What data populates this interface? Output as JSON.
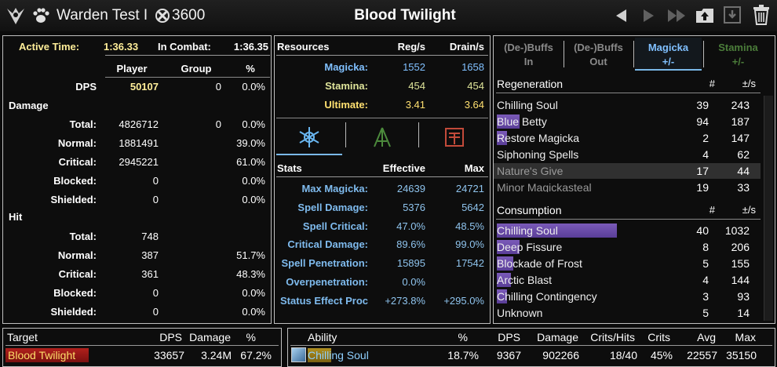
{
  "topbar": {
    "player": "Warden Test I",
    "cp": "3600",
    "title": "Blood Twilight"
  },
  "left": {
    "active_label": "Active Time:",
    "active_val": "1:36.33",
    "combat_label": "In Combat:",
    "combat_val": "1:36.35",
    "col_player": "Player",
    "col_group": "Group",
    "col_pct": "%",
    "dps_label": "DPS",
    "dps_player": "50107",
    "dps_group": "0",
    "dps_pct": "0.0%",
    "damage_header": "Damage",
    "damage": [
      {
        "label": "Total:",
        "player": "4826712",
        "group": "0",
        "pct": "0.0%"
      },
      {
        "label": "Normal:",
        "player": "1881491",
        "group": "",
        "pct": "39.0%"
      },
      {
        "label": "Critical:",
        "player": "2945221",
        "group": "",
        "pct": "61.0%"
      },
      {
        "label": "Blocked:",
        "player": "0",
        "group": "",
        "pct": "0.0%"
      },
      {
        "label": "Shielded:",
        "player": "0",
        "group": "",
        "pct": "0.0%"
      }
    ],
    "hit_header": "Hit",
    "hit": [
      {
        "label": "Total:",
        "player": "748",
        "pct": ""
      },
      {
        "label": "Normal:",
        "player": "387",
        "pct": "51.7%"
      },
      {
        "label": "Critical:",
        "player": "361",
        "pct": "48.3%"
      },
      {
        "label": "Blocked:",
        "player": "0",
        "pct": "0.0%"
      },
      {
        "label": "Shielded:",
        "player": "0",
        "pct": "0.0%"
      }
    ]
  },
  "middle": {
    "res_header": "Resources",
    "reg_header": "Reg/s",
    "drain_header": "Drain/s",
    "resources": [
      {
        "label": "Magicka:",
        "reg": "1552",
        "drain": "1658",
        "color": "#80c0ff"
      },
      {
        "label": "Stamina:",
        "reg": "454",
        "drain": "454",
        "color": "#dfe49a"
      },
      {
        "label": "Ultimate:",
        "reg": "3.41",
        "drain": "3.64",
        "color": "#ffe070"
      }
    ],
    "stats_header": "Stats",
    "eff_header": "Effective",
    "max_header": "Max",
    "stats": [
      {
        "label": "Max Magicka:",
        "eff": "24639",
        "max": "24721"
      },
      {
        "label": "Spell Damage:",
        "eff": "5376",
        "max": "5642"
      },
      {
        "label": "Spell Critical:",
        "eff": "47.0%",
        "max": "48.5%"
      },
      {
        "label": "Critical Damage:",
        "eff": "89.6%",
        "max": "99.0%"
      },
      {
        "label": "Spell Penetration:",
        "eff": "15895",
        "max": "17542"
      },
      {
        "label": "Overpenetration:",
        "eff": "0.0%",
        "max": ""
      },
      {
        "label": "Status Effect Proc",
        "eff": "+273.8%",
        "max": "+295.0%"
      }
    ]
  },
  "right": {
    "tabs": [
      {
        "l1": "(De-)Buffs",
        "l2": "In"
      },
      {
        "l1": "(De-)Buffs",
        "l2": "Out"
      },
      {
        "l1": "Magicka",
        "l2": "+/-"
      },
      {
        "l1": "Stamina",
        "l2": "+/-"
      }
    ],
    "regen_header": "Regeneration",
    "hash": "#",
    "rate": "±/s",
    "regen": [
      {
        "name": "Chilling Soul",
        "n": "39",
        "r": "243",
        "fill": 0.0
      },
      {
        "name": "Blue Betty",
        "n": "94",
        "r": "187",
        "fill": 0.11
      },
      {
        "name": "Restore Magicka",
        "n": "2",
        "r": "147",
        "fill": 0.05
      },
      {
        "name": "Siphoning Spells",
        "n": "4",
        "r": "62",
        "fill": 0.0
      },
      {
        "name": "Nature's Give",
        "n": "17",
        "r": "44",
        "fill": 0.0
      },
      {
        "name": "Minor Magickasteal",
        "n": "19",
        "r": "33",
        "fill": 0.0
      }
    ],
    "cons_header": "Consumption",
    "cons": [
      {
        "name": "Chilling Soul",
        "n": "40",
        "r": "1032",
        "fill": 0.59
      },
      {
        "name": "Deep Fissure",
        "n": "8",
        "r": "206",
        "fill": 0.11
      },
      {
        "name": "Blockade of Frost",
        "n": "5",
        "r": "155",
        "fill": 0.08
      },
      {
        "name": "Arctic Blast",
        "n": "4",
        "r": "144",
        "fill": 0.07
      },
      {
        "name": "Chilling Contingency",
        "n": "3",
        "r": "93",
        "fill": 0.05
      },
      {
        "name": "Unknown",
        "n": "5",
        "r": "14",
        "fill": 0.0
      }
    ]
  },
  "target": {
    "h_target": "Target",
    "h_dps": "DPS",
    "h_damage": "Damage",
    "h_pct": "%",
    "rows": [
      {
        "name": "Blood Twilight",
        "dps": "33657",
        "damage": "3.24M",
        "pct": "67.2%",
        "fill": 0.67
      }
    ]
  },
  "ability": {
    "h_ability": "Ability",
    "h_pct": "%",
    "h_dps": "DPS",
    "h_damage": "Damage",
    "h_crits_hits": "Crits/Hits",
    "h_crits": "Crits",
    "h_avg": "Avg",
    "h_max": "Max",
    "rows": [
      {
        "name": "Chilling Soul",
        "pct": "18.7%",
        "dps": "9367",
        "damage": "902266",
        "crits_hits": "18/40",
        "crits": "45%",
        "avg": "22557",
        "max": "35150",
        "fill": 0.19
      }
    ]
  }
}
